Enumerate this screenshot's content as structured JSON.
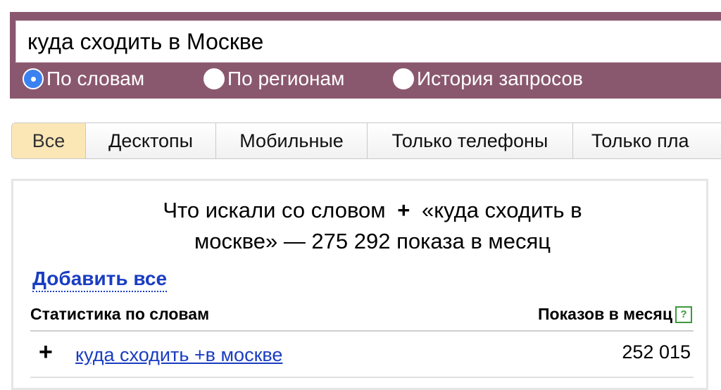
{
  "search": {
    "query": "куда сходить в Москве",
    "modes": [
      {
        "label": "По словам",
        "checked": true
      },
      {
        "label": "По регионам",
        "checked": false
      },
      {
        "label": "История запросов",
        "checked": false
      }
    ]
  },
  "tabs": [
    {
      "label": "Все",
      "active": true
    },
    {
      "label": "Десктопы",
      "active": false
    },
    {
      "label": "Мобильные",
      "active": false
    },
    {
      "label": "Только телефоны",
      "active": false
    },
    {
      "label": "Только пла",
      "active": false
    }
  ],
  "results": {
    "title_line1_prefix": "Что искали со словом",
    "title_plus": "+",
    "title_line1_suffix": "«куда сходить в",
    "title_line2": "москве» — 275 292 показа в месяц",
    "add_all": "Добавить все",
    "stats_label": "Статистика по словам",
    "shows_label": "Показов в месяц",
    "help_glyph": "?",
    "rows": [
      {
        "plus": "+",
        "phrase": "куда сходить +в москве",
        "count": "252 015"
      }
    ]
  },
  "colors": {
    "panel": "#8a586e",
    "active_tab": "#fbe7b6",
    "link": "#1a3dc1",
    "radio_checked": "#3a82f2"
  }
}
